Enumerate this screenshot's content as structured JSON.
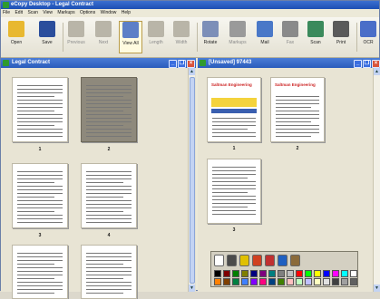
{
  "window": {
    "title": "eCopy Desktop - Legal Contract"
  },
  "menu": [
    "File",
    "Edit",
    "Scan",
    "View",
    "Markups",
    "Options",
    "Window",
    "Help"
  ],
  "toolbar": {
    "buttons": [
      {
        "label": "Open",
        "icon": "folder-open-icon",
        "color": "#e8b830",
        "state": "normal"
      },
      {
        "label": "Save",
        "icon": "floppy-disk-icon",
        "color": "#2b4e9c",
        "state": "normal"
      },
      {
        "label": "Previous",
        "icon": "previous-page-icon",
        "color": "#b9b5a8",
        "state": "disabled"
      },
      {
        "label": "Next",
        "icon": "next-page-icon",
        "color": "#b9b5a8",
        "state": "disabled"
      },
      {
        "label": "View All",
        "icon": "view-all-grid-icon",
        "color": "#5c7fc7",
        "state": "active"
      },
      {
        "label": "Length",
        "icon": "fit-length-icon",
        "color": "#b9b5a8",
        "state": "disabled"
      },
      {
        "label": "Width",
        "icon": "fit-width-icon",
        "color": "#b9b5a8",
        "state": "disabled"
      },
      {
        "label": "Rotate",
        "icon": "rotate-page-icon",
        "color": "#7d8fb8",
        "state": "normal"
      },
      {
        "label": "Markups",
        "icon": "markup-pen-icon",
        "color": "#9a9a9a",
        "state": "disabled"
      },
      {
        "label": "Mail",
        "icon": "mail-envelope-icon",
        "color": "#4a78c8",
        "state": "normal"
      },
      {
        "label": "Fax",
        "icon": "fax-machine-icon",
        "color": "#8a8a8a",
        "state": "disabled"
      },
      {
        "label": "Scan",
        "icon": "scanner-icon",
        "color": "#3b8a5c",
        "state": "normal"
      },
      {
        "label": "Print",
        "icon": "printer-icon",
        "color": "#5a5a5a",
        "state": "normal"
      },
      {
        "label": "OCR",
        "icon": "ocr-text-icon",
        "color": "#4a6ec8",
        "state": "normal"
      }
    ]
  },
  "left_pane": {
    "title": "Legal Contract",
    "pages": [
      {
        "num": "1",
        "selected": false
      },
      {
        "num": "2",
        "selected": true
      },
      {
        "num": "3",
        "selected": false
      },
      {
        "num": "4",
        "selected": false
      },
      {
        "num": "",
        "selected": false
      },
      {
        "num": "",
        "selected": false
      }
    ]
  },
  "right_pane": {
    "title": "[Unsaved] 97443",
    "pages": [
      {
        "num": "1",
        "brand": "Saltman Engineering"
      },
      {
        "num": "2",
        "brand": "Saltman Engineering"
      },
      {
        "num": "3",
        "brand": ""
      }
    ]
  },
  "palette": {
    "tools": [
      {
        "icon": "select-arrow-icon",
        "color": "#ffffff"
      },
      {
        "icon": "text-tool-icon",
        "color": "#4a4a4a"
      },
      {
        "icon": "highlighter-icon",
        "color": "#e0c000"
      },
      {
        "icon": "arrow-tool-icon",
        "color": "#d04020"
      },
      {
        "icon": "stamp-icon",
        "color": "#c03030"
      },
      {
        "icon": "pen-icon",
        "color": "#2060c0"
      },
      {
        "icon": "eraser-icon",
        "color": "#8a6a3a"
      }
    ],
    "colors": [
      "#000000",
      "#7f0000",
      "#007f00",
      "#7f7f00",
      "#00007f",
      "#7f007f",
      "#007f7f",
      "#808080",
      "#c0c0c0",
      "#ff0000",
      "#00ff00",
      "#ffff00",
      "#0000ff",
      "#ff00ff",
      "#00ffff",
      "#ffffff",
      "#ff8000",
      "#804000",
      "#008040",
      "#4080ff",
      "#8000ff",
      "#ff0080",
      "#004080",
      "#408000",
      "#ffc0c0",
      "#c0ffc0",
      "#c0c0ff",
      "#ffffc0",
      "#e0e0e0",
      "#404040",
      "#a0a0a0",
      "#606060"
    ]
  }
}
